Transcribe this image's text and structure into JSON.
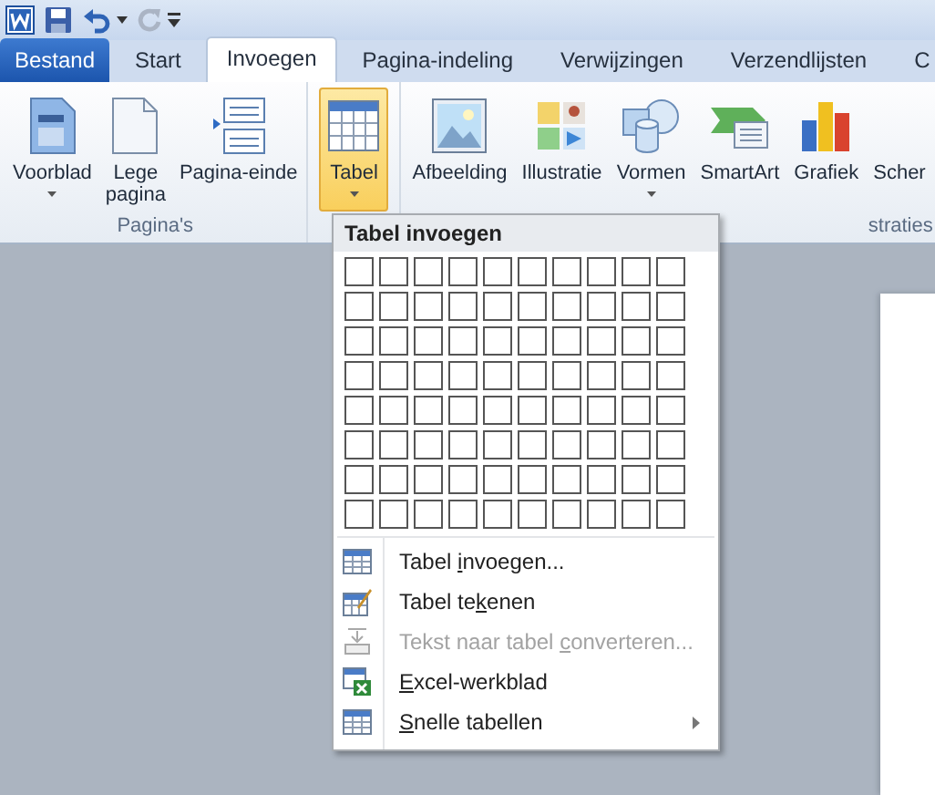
{
  "tabs": [
    {
      "label": "Bestand",
      "kind": "file",
      "selected": false
    },
    {
      "label": "Start",
      "kind": "tab",
      "selected": false
    },
    {
      "label": "Invoegen",
      "kind": "tab",
      "selected": true
    },
    {
      "label": "Pagina-indeling",
      "kind": "tab",
      "selected": false
    },
    {
      "label": "Verwijzingen",
      "kind": "tab",
      "selected": false
    },
    {
      "label": "Verzendlijsten",
      "kind": "tab",
      "selected": false
    },
    {
      "label": "C",
      "kind": "tab",
      "selected": false
    }
  ],
  "groups": [
    {
      "label": "Pagina's",
      "buttons": [
        {
          "label": "Voorblad",
          "kind": "cover",
          "dropdown": true,
          "selected": false
        },
        {
          "label": "Lege pagina",
          "kind": "blank",
          "dropdown": false,
          "selected": false
        },
        {
          "label": "Pagina-einde",
          "kind": "pagebreak",
          "dropdown": false,
          "selected": false
        }
      ]
    },
    {
      "buttons": [
        {
          "label": "Tabel",
          "kind": "table",
          "dropdown": true,
          "selected": true
        }
      ]
    },
    {
      "label": "straties",
      "buttons": [
        {
          "label": "Afbeelding",
          "kind": "picture",
          "dropdown": false,
          "selected": false
        },
        {
          "label": "Illustratie",
          "kind": "clipart",
          "dropdown": false,
          "selected": false
        },
        {
          "label": "Vormen",
          "kind": "shapes",
          "dropdown": true,
          "selected": false
        },
        {
          "label": "SmartArt",
          "kind": "smartart",
          "dropdown": false,
          "selected": false
        },
        {
          "label": "Grafiek",
          "kind": "chart",
          "dropdown": false,
          "selected": false
        },
        {
          "label": "Scher",
          "kind": "cut",
          "dropdown": false,
          "selected": false
        }
      ]
    }
  ],
  "dropdown": {
    "title": "Tabel invoegen",
    "items": [
      {
        "pre": "Tabel ",
        "key": "i",
        "post": "nvoegen...",
        "kind": "table",
        "disabled": false,
        "submenu": false
      },
      {
        "pre": "Tabel te",
        "key": "k",
        "post": "enen",
        "kind": "draw",
        "disabled": false,
        "submenu": false
      },
      {
        "pre": "Tekst naar tabel ",
        "key": "c",
        "post": "onverteren...",
        "kind": "convert",
        "disabled": true,
        "submenu": false
      },
      {
        "key": "E",
        "post": "xcel-werkblad",
        "kind": "excel",
        "disabled": false,
        "submenu": false
      },
      {
        "key": "S",
        "post": "nelle tabellen",
        "kind": "table",
        "disabled": false,
        "submenu": true
      }
    ]
  }
}
